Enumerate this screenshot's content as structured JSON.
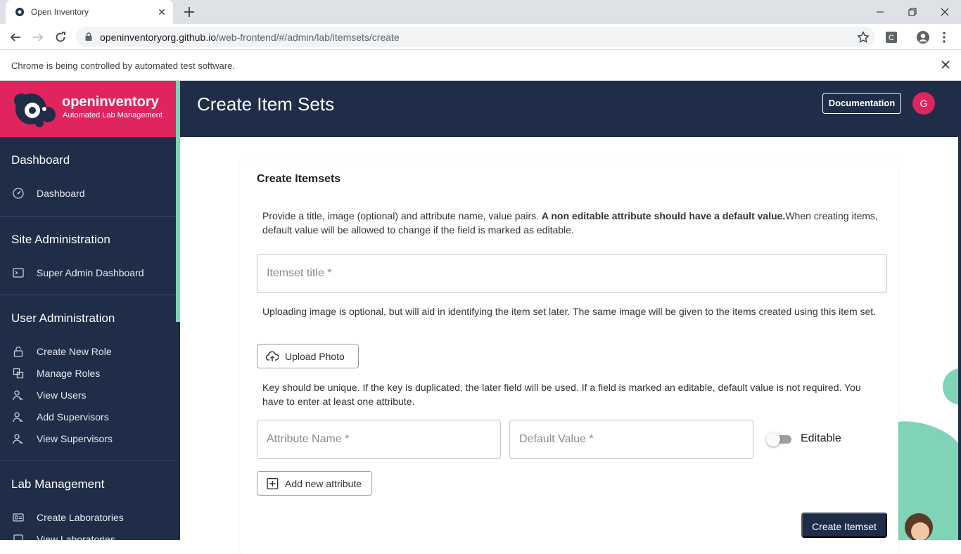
{
  "browser": {
    "tab_title": "Open Inventory",
    "url_host": "openinventoryorg.github.io",
    "url_path": "/web-frontend/#/admin/lab/itemsets/create",
    "infobar_text": "Chrome is being controlled by automated test software."
  },
  "brand": {
    "name": "openinventory",
    "tagline": "Automated Lab Management"
  },
  "sidebar": {
    "sections": [
      {
        "title": "Dashboard",
        "items": [
          {
            "label": "Dashboard",
            "icon": "gauge-icon"
          }
        ]
      },
      {
        "title": "Site Administration",
        "items": [
          {
            "label": "Super Admin Dashboard",
            "icon": "terminal-icon"
          }
        ]
      },
      {
        "title": "User Administration",
        "items": [
          {
            "label": "Create New Role",
            "icon": "lock-icon"
          },
          {
            "label": "Manage Roles",
            "icon": "layers-icon"
          },
          {
            "label": "View Users",
            "icon": "users-icon"
          },
          {
            "label": "Add Supervisors",
            "icon": "users-icon"
          },
          {
            "label": "View Supervisors",
            "icon": "users-icon"
          }
        ]
      },
      {
        "title": "Lab Management",
        "items": [
          {
            "label": "Create Laboratories",
            "icon": "id-card-icon"
          },
          {
            "label": "View Laboratories",
            "icon": "square-icon"
          }
        ]
      }
    ]
  },
  "header": {
    "title": "Create Item Sets",
    "documentation_label": "Documentation",
    "avatar_initial": "G"
  },
  "card": {
    "title": "Create Itemsets",
    "intro_text": "Provide a title, image (optional) and attribute name, value pairs. ",
    "intro_bold": "A non editable attribute should have a default value.",
    "intro_tail": "When creating items, default value will be allowed to change if the field is marked as editable.",
    "title_placeholder": "Itemset title *",
    "image_help": "Uploading image is optional, but will aid in identifying the item set later. The same image will be given to the items created using this item set.",
    "upload_label": "Upload Photo",
    "key_help": "Key should be unique. If the key is duplicated, the later field will be used. If a field is marked an editable, default value is not required. You have to enter at least one attribute.",
    "attribute_name_placeholder": "Attribute Name *",
    "default_value_placeholder": "Default Value *",
    "editable_label": "Editable",
    "editable_checked": false,
    "add_attribute_label": "Add new attribute",
    "submit_label": "Create Itemset"
  },
  "colors": {
    "primary": "#1f2d48",
    "brand": "#e0245e",
    "accent": "#7fd4b5"
  }
}
